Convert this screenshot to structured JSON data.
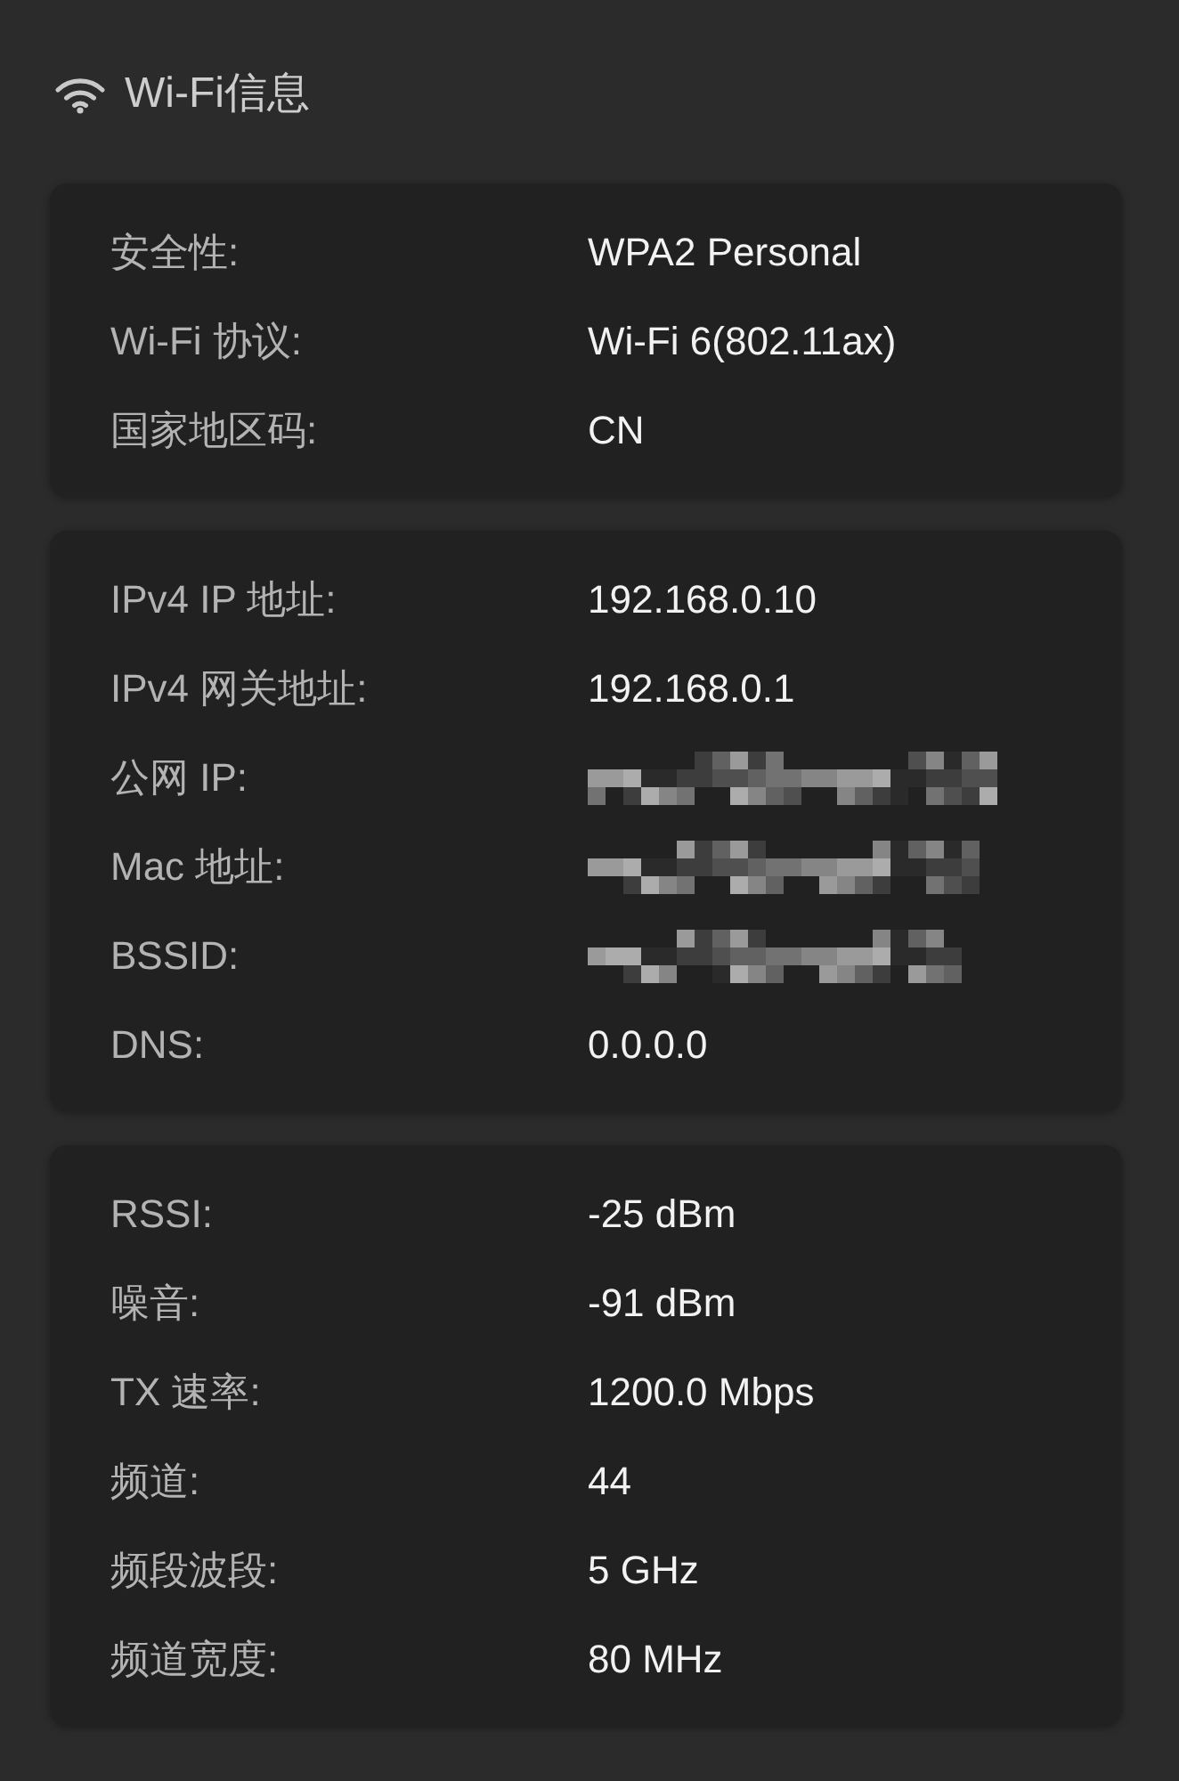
{
  "header": {
    "title": "Wi-Fi信息"
  },
  "sections": [
    {
      "rows": [
        {
          "kind": "text",
          "label": "安全性:",
          "value": "WPA2 Personal"
        },
        {
          "kind": "text",
          "label": "Wi-Fi 协议:",
          "value": "Wi-Fi 6(802.11ax)"
        },
        {
          "kind": "text",
          "label": "国家地区码:",
          "value": "CN"
        }
      ]
    },
    {
      "rows": [
        {
          "kind": "text",
          "label": "IPv4 IP 地址:",
          "value": "192.168.0.10"
        },
        {
          "kind": "text",
          "label": "IPv4 网关地址:",
          "value": "192.168.0.1"
        },
        {
          "kind": "redacted",
          "label": "公网 IP:"
        },
        {
          "kind": "redacted",
          "label": "Mac 地址:"
        },
        {
          "kind": "redacted",
          "label": "BSSID:"
        },
        {
          "kind": "text",
          "label": "DNS:",
          "value": "0.0.0.0"
        }
      ]
    },
    {
      "rows": [
        {
          "kind": "text",
          "label": "RSSI:",
          "value": "-25 dBm"
        },
        {
          "kind": "text",
          "label": "噪音:",
          "value": "-91 dBm"
        },
        {
          "kind": "text",
          "label": "TX 速率:",
          "value": "1200.0 Mbps"
        },
        {
          "kind": "text",
          "label": "频道:",
          "value": "44"
        },
        {
          "kind": "text",
          "label": "频段波段:",
          "value": "5 GHz"
        },
        {
          "kind": "text",
          "label": "频道宽度:",
          "value": "80 MHz"
        }
      ]
    }
  ]
}
